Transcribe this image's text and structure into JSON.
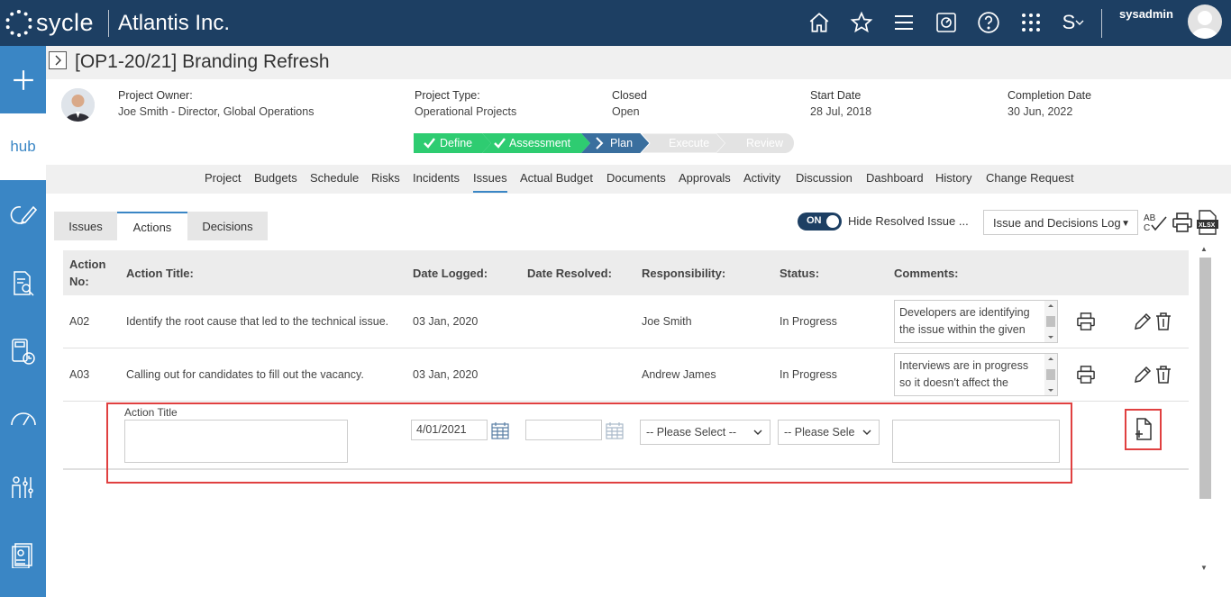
{
  "app": {
    "logo_text": "sycle",
    "company": "Atlantis Inc.",
    "username": "sysadmin",
    "user_menu_initial": "S"
  },
  "topbar_icons": [
    "home-icon",
    "star-icon",
    "menu-icon",
    "dashboard-icon",
    "help-icon",
    "apps-grid-icon"
  ],
  "sidebar": {
    "hub_label": "hub",
    "items": [
      "add-icon",
      "hub",
      "refresh-edit-icon",
      "search-document-icon",
      "calculator-clock-icon",
      "gauge-icon",
      "people-settings-icon",
      "report-icon"
    ]
  },
  "page": {
    "title": "[OP1-20/21] Branding Refresh"
  },
  "project": {
    "owner_label": "Project Owner:",
    "owner_value": "Joe Smith - Director, Global Operations",
    "type_label": "Project Type:",
    "type_value": "Operational Projects",
    "closed_label": "Closed",
    "closed_value": "Open",
    "start_label": "Start Date",
    "start_value": "28 Jul, 2018",
    "completion_label": "Completion Date",
    "completion_value": "30 Jun, 2022"
  },
  "stages": [
    {
      "label": "Define",
      "state": "done",
      "color": "#2ecc71"
    },
    {
      "label": "Assessment",
      "state": "done",
      "color": "#2ecc71"
    },
    {
      "label": "Plan",
      "state": "current",
      "color": "#3a6f9e"
    },
    {
      "label": "Execute",
      "state": "pending",
      "color": "#e3e3e3"
    },
    {
      "label": "Review",
      "state": "pending",
      "color": "#e3e3e3"
    }
  ],
  "nav_tabs": [
    "Project",
    "Budgets",
    "Schedule",
    "Risks",
    "Incidents",
    "Issues",
    "Actual Budget",
    "Documents",
    "Approvals",
    "Activity",
    "Discussion",
    "Dashboard",
    "History",
    "Change Request"
  ],
  "nav_active": "Issues",
  "sub_tabs": [
    "Issues",
    "Actions",
    "Decisions"
  ],
  "sub_active": "Actions",
  "toolbar": {
    "toggle_state": "ON",
    "toggle_label": "Hide Resolved Issue ...",
    "report_select": "Issue and Decisions Log"
  },
  "table": {
    "headers": {
      "no_line1": "Action",
      "no_line2": "No:",
      "title": "Action Title:",
      "logged": "Date Logged:",
      "resolved": "Date Resolved:",
      "responsibility": "Responsibility:",
      "status": "Status:",
      "comments": "Comments:"
    },
    "rows": [
      {
        "no": "A02",
        "title": "Identify the root cause that led to the technical issue.",
        "logged": "03 Jan, 2020",
        "resolved": "",
        "responsibility": "Joe Smith",
        "status": "In Progress",
        "comment": "Developers are identifying the issue within the given"
      },
      {
        "no": "A03",
        "title": "Calling out for candidates to fill out the vacancy.",
        "logged": "03 Jan, 2020",
        "resolved": "",
        "responsibility": "Andrew James",
        "status": "In Progress",
        "comment": "Interviews are in progress so it doesn't affect the"
      }
    ],
    "new_row": {
      "title_label": "Action Title",
      "title_value": "",
      "date_logged": "4/01/2021",
      "date_resolved": "",
      "responsibility_select": "-- Please Select --",
      "status_select": "-- Please Sele",
      "comment_value": ""
    }
  }
}
